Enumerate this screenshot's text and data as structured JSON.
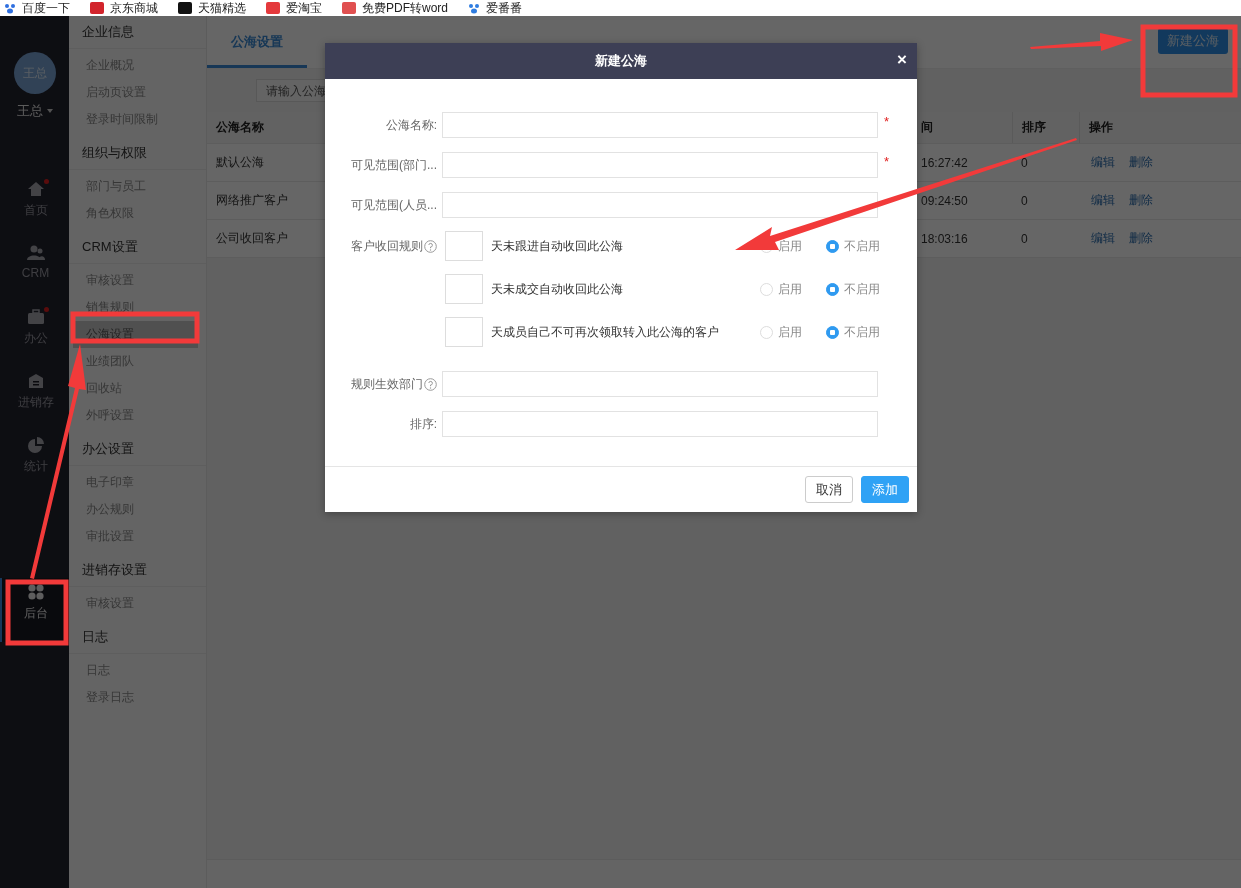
{
  "bookmarks": [
    {
      "label": "百度一下",
      "color": "#2f6fe0"
    },
    {
      "label": "京东商城",
      "color": "#d2242c"
    },
    {
      "label": "天猫精选",
      "color": "#111111"
    },
    {
      "label": "爱淘宝",
      "color": "#e4393c"
    },
    {
      "label": "免费PDF转word",
      "color": "#e05050"
    },
    {
      "label": "爱番番",
      "color": "#2f7de1"
    }
  ],
  "nav": {
    "avatar": "王总",
    "user": "王总",
    "items": [
      {
        "label": "首页",
        "badge": true,
        "selected": false
      },
      {
        "label": "CRM",
        "badge": false,
        "selected": false
      },
      {
        "label": "办公",
        "badge": true,
        "selected": false
      },
      {
        "label": "进销存",
        "badge": false,
        "selected": false
      },
      {
        "label": "统计",
        "badge": false,
        "selected": false
      },
      {
        "label": "后台",
        "badge": false,
        "selected": true
      }
    ]
  },
  "subnav": [
    {
      "title": "企业信息",
      "items": [
        {
          "label": "企业概况",
          "selected": false
        },
        {
          "label": "启动页设置",
          "selected": false
        },
        {
          "label": "登录时间限制",
          "selected": false
        }
      ]
    },
    {
      "title": "组织与权限",
      "items": [
        {
          "label": "部门与员工",
          "selected": false
        },
        {
          "label": "角色权限",
          "selected": false
        }
      ]
    },
    {
      "title": "CRM设置",
      "items": [
        {
          "label": "审核设置",
          "selected": false
        },
        {
          "label": "销售规则",
          "selected": false
        },
        {
          "label": "公海设置",
          "selected": true
        },
        {
          "label": "业绩团队",
          "selected": false
        },
        {
          "label": "回收站",
          "selected": false
        },
        {
          "label": "外呼设置",
          "selected": false
        }
      ]
    },
    {
      "title": "办公设置",
      "items": [
        {
          "label": "电子印章",
          "selected": false
        },
        {
          "label": "办公规则",
          "selected": false
        },
        {
          "label": "审批设置",
          "selected": false
        }
      ]
    },
    {
      "title": "进销存设置",
      "items": [
        {
          "label": "审核设置",
          "selected": false
        }
      ]
    },
    {
      "title": "日志",
      "items": [
        {
          "label": "日志",
          "selected": false
        },
        {
          "label": "登录日志",
          "selected": false
        }
      ]
    }
  ],
  "content": {
    "tabs": [
      {
        "label": "公海设置",
        "selected": true
      }
    ],
    "new_button": "新建公海",
    "search": {
      "placeholder": "请输入公海"
    },
    "table": {
      "columns": [
        "公海名称",
        "间",
        "排序",
        "操作"
      ],
      "rows": [
        {
          "name": "默认公海",
          "time": "16:27:42",
          "order": "0",
          "actions": [
            "编辑",
            "删除"
          ]
        },
        {
          "name": "网络推广客户",
          "time": "09:24:50",
          "order": "0",
          "actions": [
            "编辑",
            "删除"
          ]
        },
        {
          "name": "公司收回客户",
          "time": "18:03:16",
          "order": "0",
          "actions": [
            "编辑",
            "删除"
          ]
        }
      ]
    }
  },
  "modal": {
    "title": "新建公海",
    "close": "×",
    "fields": [
      {
        "label": "公海名称:",
        "required_mark": "*"
      },
      {
        "label": "可见范围(部门...",
        "required_mark": "*"
      },
      {
        "label": "可见范围(人员..."
      }
    ],
    "rules_label": "客户收回规则",
    "rules": [
      {
        "text": "天未跟进自动收回此公海",
        "options": [
          {
            "label": "启用",
            "selected": false
          },
          {
            "label": "不启用",
            "selected": true
          }
        ]
      },
      {
        "text": "天未成交自动收回此公海",
        "options": [
          {
            "label": "启用",
            "selected": false
          },
          {
            "label": "不启用",
            "selected": true
          }
        ]
      },
      {
        "text": "天成员自己不可再次领取转入此公海的客户",
        "options": [
          {
            "label": "启用",
            "selected": false
          },
          {
            "label": "不启用",
            "selected": true
          }
        ]
      }
    ],
    "dept_field": {
      "label": "规则生效部门"
    },
    "order_field": {
      "label": "排序:"
    },
    "buttons": [
      {
        "label": "取消",
        "kind": "secondary"
      },
      {
        "label": "添加",
        "kind": "primary"
      }
    ]
  }
}
